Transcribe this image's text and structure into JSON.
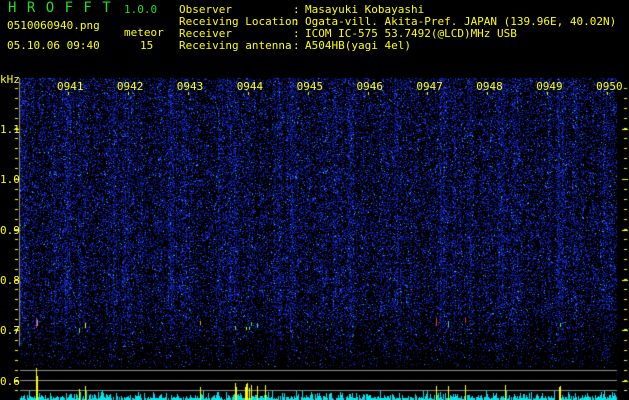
{
  "app": {
    "title": "H R O F F T",
    "version": "1.0.0"
  },
  "file": {
    "name": "0510060940.png",
    "datetime": "05.10.06 09:40"
  },
  "meteor": {
    "label": "meteor",
    "count": "15"
  },
  "info": [
    {
      "key": "Observer",
      "value": "Masayuki Kobayashi"
    },
    {
      "key": "Receiving Location",
      "value": "Ogata-vill. Akita-Pref. JAPAN (139.96E, 40.02N)"
    },
    {
      "key": "Receiver",
      "value": "ICOM IC-575 53.7492(@LCD)MHz USB"
    },
    {
      "key": "Receiving antenna",
      "value": "A504HB(yagi 4el)"
    }
  ],
  "axis": {
    "unit": "kHz",
    "freq_ticks": [
      "1.1",
      "1.0",
      "0.9",
      "0.8",
      "0.7",
      "0.6"
    ],
    "time_ticks": [
      "0941",
      "0942",
      "0943",
      "0944",
      "0945",
      "0946",
      "0947",
      "0948",
      "0949",
      "0950"
    ]
  },
  "colors": {
    "text": "#ffff00",
    "title": "#22dd22",
    "background": "#000000",
    "noise": "#1a2ad0",
    "histogram": "#00e5ee",
    "detection": "#ffff00",
    "gridline": "#909090"
  }
}
